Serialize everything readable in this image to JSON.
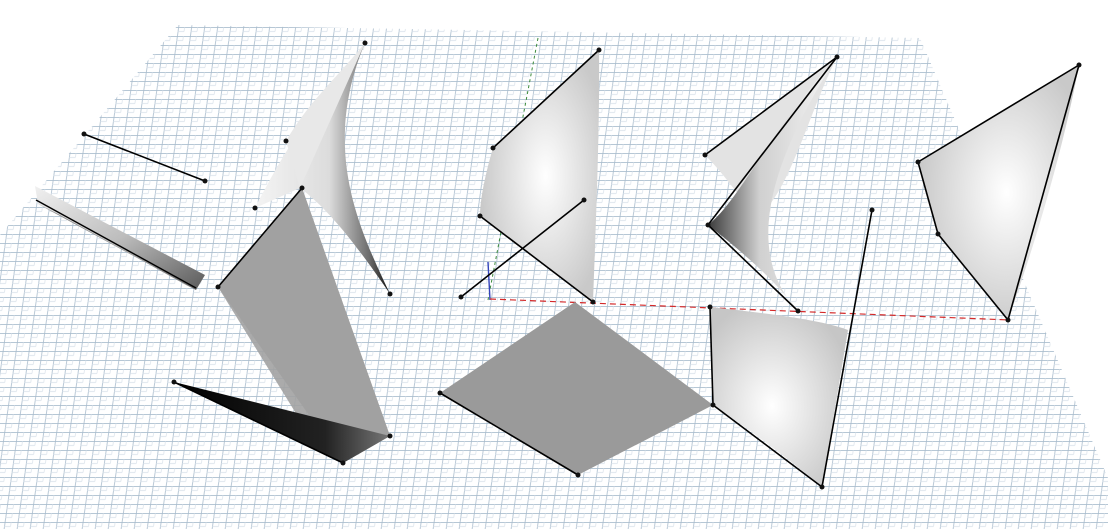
{
  "viewport": {
    "background": "#ffffff",
    "grid_colors": [
      "#9fb3c6",
      "#c4d3e0",
      "#d6e0ea"
    ],
    "axis_x_color": "#d42a2a",
    "axis_y_color": "#3a8a3a",
    "axis_z_color": "#3344bb",
    "edge_color": "#000000",
    "vertex_color": "#111111"
  }
}
